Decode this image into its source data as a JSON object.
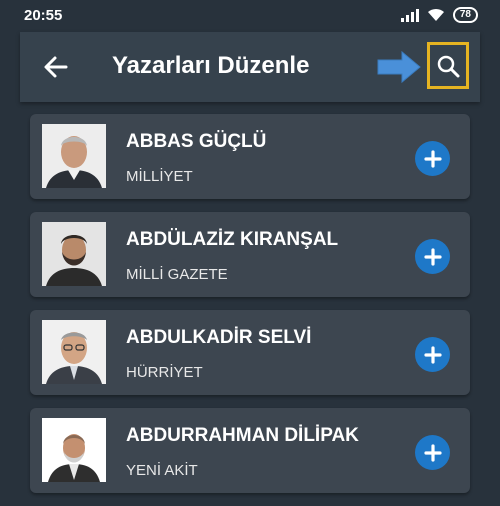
{
  "status_bar": {
    "time": "20:55",
    "battery": "78"
  },
  "header": {
    "title": "Yazarları Düzenle",
    "back_icon": "arrow-left-icon",
    "search_icon": "search-icon"
  },
  "authors": [
    {
      "name": "ABBAS GÜÇLÜ",
      "paper": "MİLLİYET"
    },
    {
      "name": "ABDÜLAZİZ KIRANŞAL",
      "paper": "MİLLİ GAZETE"
    },
    {
      "name": "ABDULKADİR SELVİ",
      "paper": "HÜRRİYET"
    },
    {
      "name": "ABDURRAHMAN DİLİPAK",
      "paper": "YENİ AKİT"
    }
  ],
  "colors": {
    "background": "#28323c",
    "app_bar": "#36424d",
    "card": "#3d4650",
    "add_button": "#1e78c8",
    "search_highlight": "#e6b422",
    "hint_arrow": "#4a90d9"
  }
}
